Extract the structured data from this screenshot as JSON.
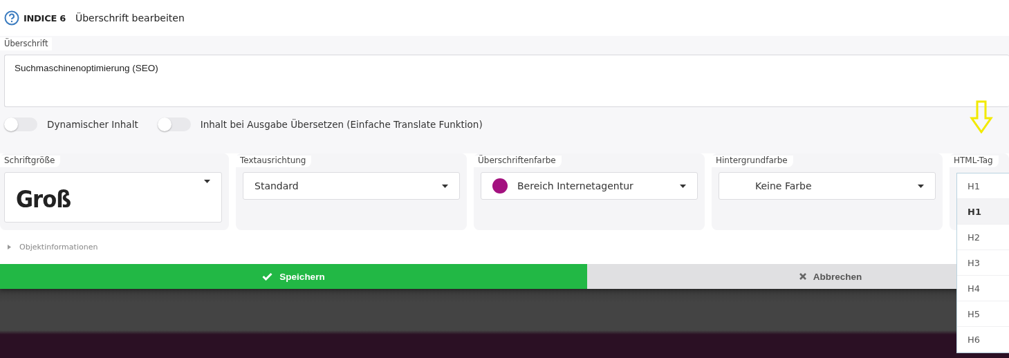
{
  "header": {
    "index_label": "INDICE 6",
    "title": "Überschrift bearbeiten"
  },
  "heading_field": {
    "label": "Überschrift",
    "value": "Suchmaschinenoptimierung (SEO)"
  },
  "toggles": [
    {
      "label": "Dynamischer Inhalt",
      "on": false
    },
    {
      "label": "Inhalt bei Ausgabe Übersetzen (Einfache Translate Funktion)",
      "on": false
    }
  ],
  "selects": [
    {
      "label": "Schriftgröße",
      "value": "Groß",
      "kind": "size"
    },
    {
      "label": "Textausrichtung",
      "value": "Standard",
      "kind": "plain"
    },
    {
      "label": "Überschriftenfarbe",
      "value": "Bereich Internetagentur",
      "kind": "color",
      "color": "#a3117f"
    },
    {
      "label": "Hintergrundfarbe",
      "value": "Keine Farbe",
      "kind": "color"
    },
    {
      "label": "HTML-Tag",
      "value": "H1",
      "kind": "dropdown",
      "expanded": true,
      "options": [
        {
          "label": "H1",
          "selected": true
        },
        {
          "label": "H2",
          "selected": false
        },
        {
          "label": "H3",
          "selected": false
        },
        {
          "label": "H4",
          "selected": false
        },
        {
          "label": "H5",
          "selected": false
        },
        {
          "label": "H6",
          "selected": false
        }
      ]
    }
  ],
  "object_info": {
    "label": "Objektinformationen",
    "expanded": false
  },
  "buttons": [
    {
      "label": "Speichern",
      "kind": "save"
    },
    {
      "label": "Abbrechen",
      "kind": "cancel"
    }
  ]
}
